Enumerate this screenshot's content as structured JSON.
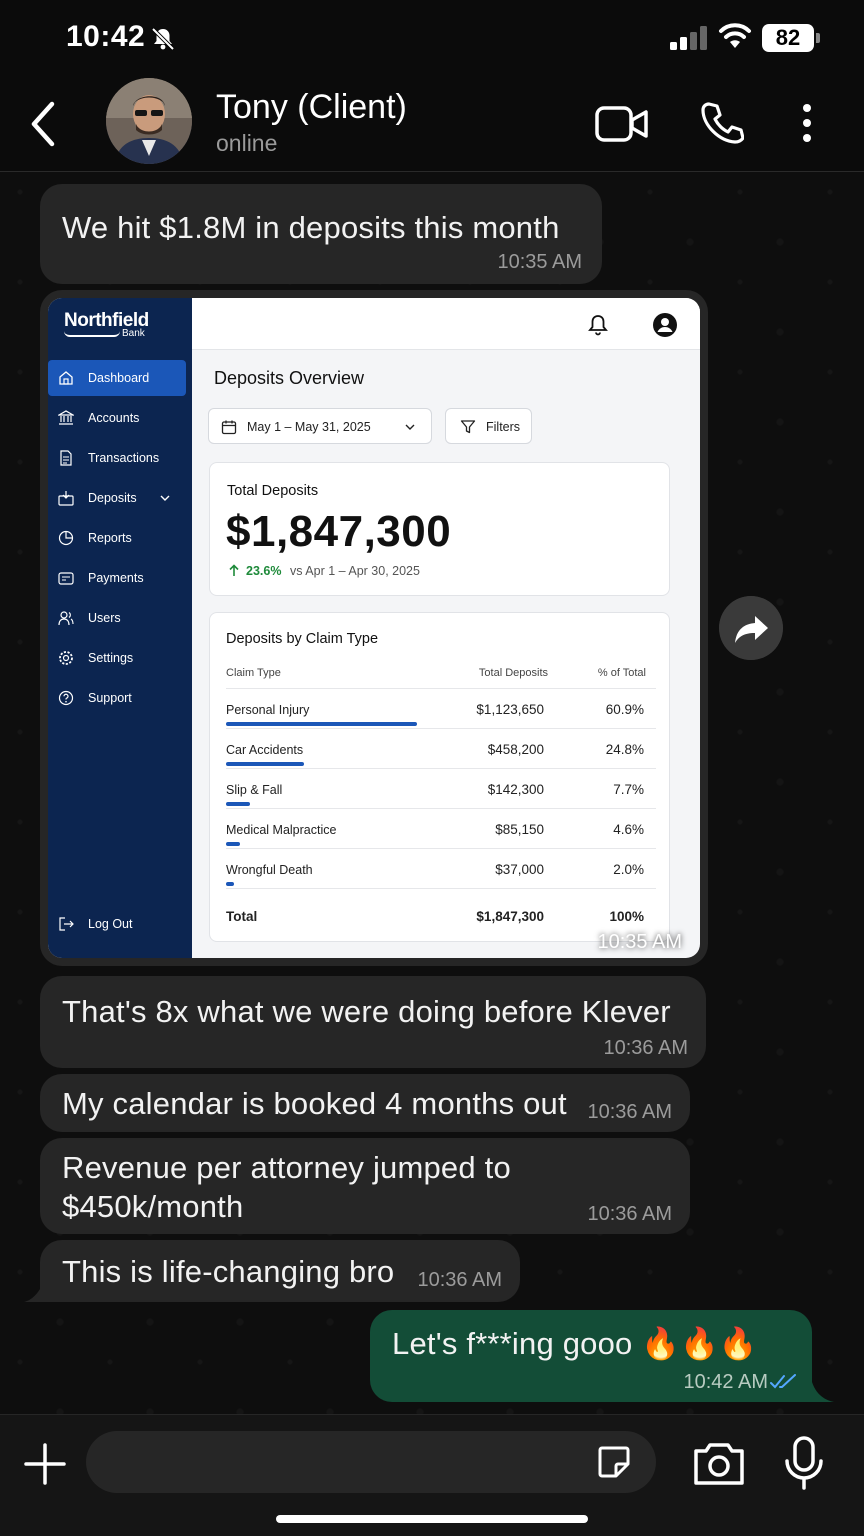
{
  "status": {
    "time": "10:42",
    "battery": "82"
  },
  "header": {
    "name": "Tony (Client)",
    "presence": "online"
  },
  "messages": [
    {
      "text": "We hit $1.8M in deposits this month",
      "time": "10:35 AM"
    },
    {
      "text": "That's 8x what we were doing before Klever",
      "time": "10:36 AM"
    },
    {
      "text": "My calendar is booked 4 months out",
      "time": "10:36 AM"
    },
    {
      "text_line1": "Revenue per attorney jumped to",
      "text_line2": "$450k/month",
      "time": "10:36 AM"
    },
    {
      "text": "This is life-changing bro",
      "time": "10:36 AM"
    },
    {
      "text": "Let's f***ing gooo 🔥🔥🔥",
      "time": "10:42 AM"
    }
  ],
  "image_time": "10:35 AM",
  "dashboard": {
    "brand": "Northfield",
    "brand_sub": "Bank",
    "nav": [
      {
        "label": "Dashboard",
        "icon": "home-icon"
      },
      {
        "label": "Accounts",
        "icon": "bank-icon"
      },
      {
        "label": "Transactions",
        "icon": "document-icon"
      },
      {
        "label": "Deposits",
        "icon": "deposit-icon"
      },
      {
        "label": "Reports",
        "icon": "pie-chart-icon"
      },
      {
        "label": "Payments",
        "icon": "wallet-icon"
      },
      {
        "label": "Users",
        "icon": "users-icon"
      },
      {
        "label": "Settings",
        "icon": "gear-icon"
      },
      {
        "label": "Support",
        "icon": "help-icon"
      }
    ],
    "logout": "Log Out",
    "title": "Deposits Overview",
    "date_range": "May 1 – May 31, 2025",
    "filters": "Filters",
    "total_label": "Total Deposits",
    "total_value": "$1,847,300",
    "change_pct": "23.6%",
    "change_compare": "vs Apr 1 – Apr 30, 2025",
    "breakdown_title": "Deposits by Claim Type",
    "col_type": "Claim Type",
    "col_total": "Total Deposits",
    "col_pct": "% of Total",
    "rows": [
      {
        "type": "Personal Injury",
        "total": "$1,123,650",
        "pct": "60.9%",
        "share": 0.609
      },
      {
        "type": "Car Accidents",
        "total": "$458,200",
        "pct": "24.8%",
        "share": 0.248
      },
      {
        "type": "Slip & Fall",
        "total": "$142,300",
        "pct": "7.7%",
        "share": 0.077
      },
      {
        "type": "Medical Malpractice",
        "total": "$85,150",
        "pct": "4.6%",
        "share": 0.046
      },
      {
        "type": "Wrongful Death",
        "total": "$37,000",
        "pct": "2.0%",
        "share": 0.02
      }
    ],
    "total_row": {
      "label": "Total",
      "total": "$1,847,300",
      "pct": "100%"
    }
  }
}
